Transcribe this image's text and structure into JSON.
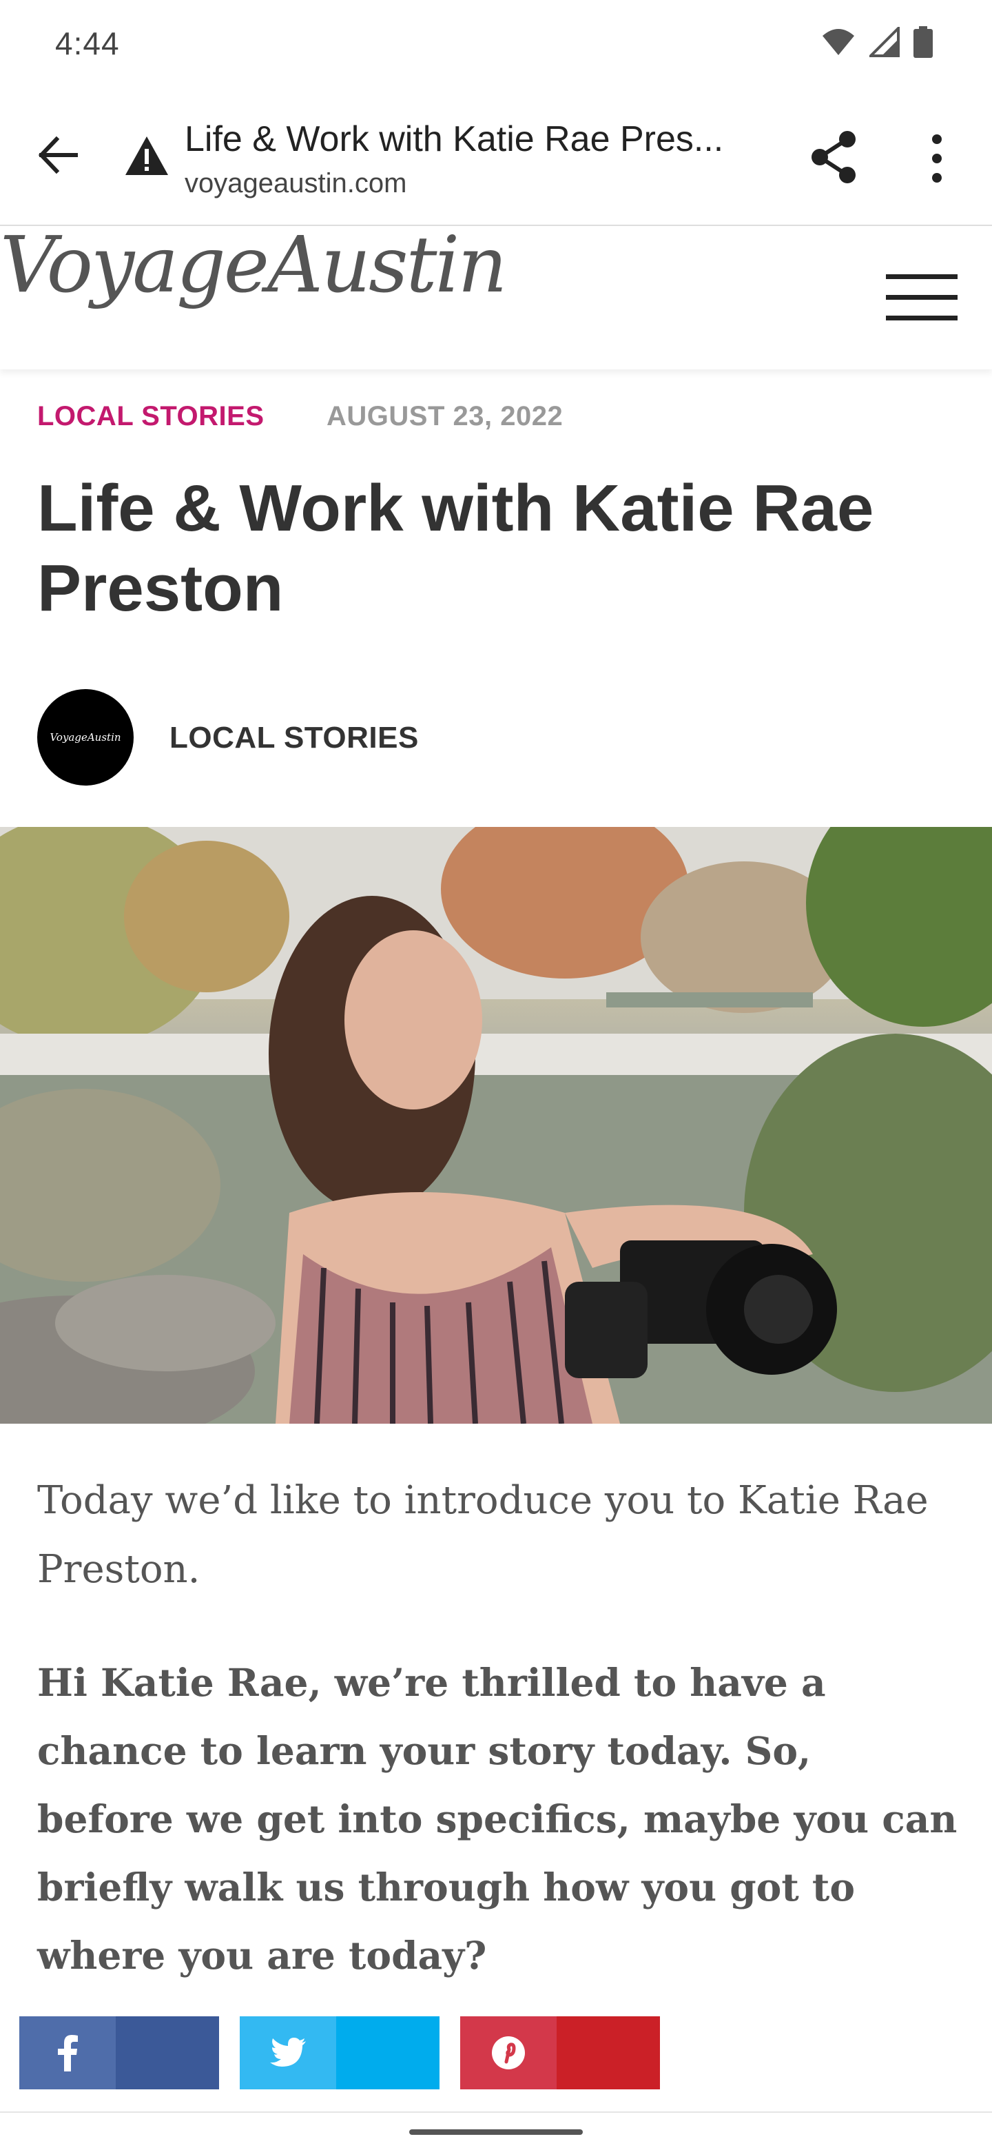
{
  "status_bar": {
    "time": "4:44",
    "icons": [
      "wifi-icon",
      "signal-icon",
      "battery-icon"
    ]
  },
  "browser": {
    "page_title": "Life & Work with Katie Rae Pres...",
    "domain": "voyageaustin.com",
    "icons": [
      "back-arrow-icon",
      "warning-icon",
      "share-icon",
      "more-vert-icon"
    ]
  },
  "site": {
    "logo_text": "VoyageAustin",
    "menu_icon": "hamburger-icon"
  },
  "article": {
    "category": "LOCAL STORIES",
    "date": "AUGUST 23, 2022",
    "title": "Life & Work with Katie Rae Preston",
    "author_avatar_text": "VoyageAustin",
    "author_name": "LOCAL STORIES",
    "intro": "Today we’d like to introduce you to Katie Rae Preston.",
    "question": "Hi Katie Rae, we’re thrilled to have a chance to learn your story today. So, before we get into specifics, maybe you can briefly walk us through how you got to where you are today?"
  },
  "share_buttons": [
    {
      "network": "facebook",
      "icon": "facebook-icon",
      "color": "#3b5998"
    },
    {
      "network": "twitter",
      "icon": "twitter-icon",
      "color": "#00aced"
    },
    {
      "network": "pinterest",
      "icon": "pinterest-icon",
      "color": "#cb2027"
    }
  ],
  "colors": {
    "accent": "#c3196e",
    "date_gray": "#999999",
    "text_dark": "#333333"
  }
}
